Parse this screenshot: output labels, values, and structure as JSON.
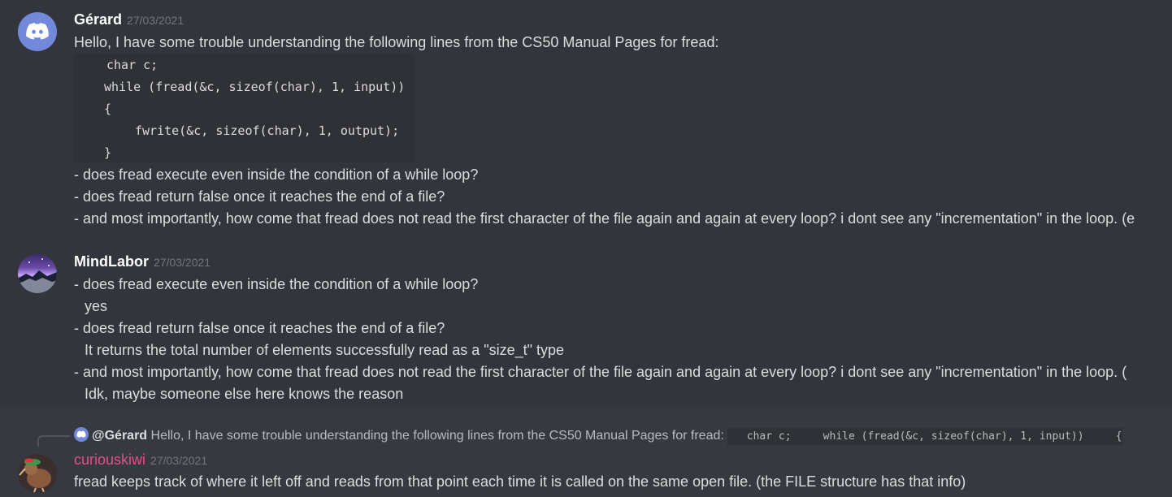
{
  "messages": [
    {
      "author": "Gérard",
      "timestamp": "27/03/2021",
      "intro": "Hello, I have some trouble understanding the following lines from the CS50 Manual Pages for fread:",
      "code": {
        "l1": "char c;",
        "l2": "while (fread(&c, sizeof(char), 1, input))",
        "l3": "{",
        "l4": "fwrite(&c, sizeof(char), 1, output);",
        "l5": "}"
      },
      "questions": [
        "- does fread execute even inside the condition of a while loop?",
        "- does fread return false once it reaches the end of a file?",
        "- and most importantly, how come that fread does not read the first character of the file again and again at every loop? i dont see any \"incrementation\" in the loop. (e"
      ]
    },
    {
      "author": "MindLabor",
      "timestamp": "27/03/2021",
      "lines": [
        "- does fread execute even inside the condition of a while loop?",
        "yes",
        "- does fread return false once it reaches the end of a file?",
        "It returns the total number of elements successfully read as a \"size_t\" type",
        "- and most importantly, how come that fread does not read the first character of the file again and again at every loop? i dont see any \"incrementation\" in the loop. (",
        "Idk, maybe someone else here knows the reason"
      ]
    },
    {
      "author": "curiouskiwi",
      "timestamp": "27/03/2021",
      "reply": {
        "mention": "@Gérard",
        "text": "Hello, I have some trouble understanding the following lines from the CS50 Manual Pages for fread:",
        "code": "   char c;     while (fread(&c, sizeof(char), 1, input))     {"
      },
      "text": "fread keeps track of where it left off and reads from that point each time it is called on the same open file.  (the FILE structure has that info)"
    }
  ],
  "icons": {
    "discord": "discord-logo-icon",
    "reply": "reply-spine-icon"
  },
  "colors": {
    "background": "#36393f",
    "hover": "#32353b",
    "mention": "#e74c8c",
    "blurple": "#7289da"
  }
}
